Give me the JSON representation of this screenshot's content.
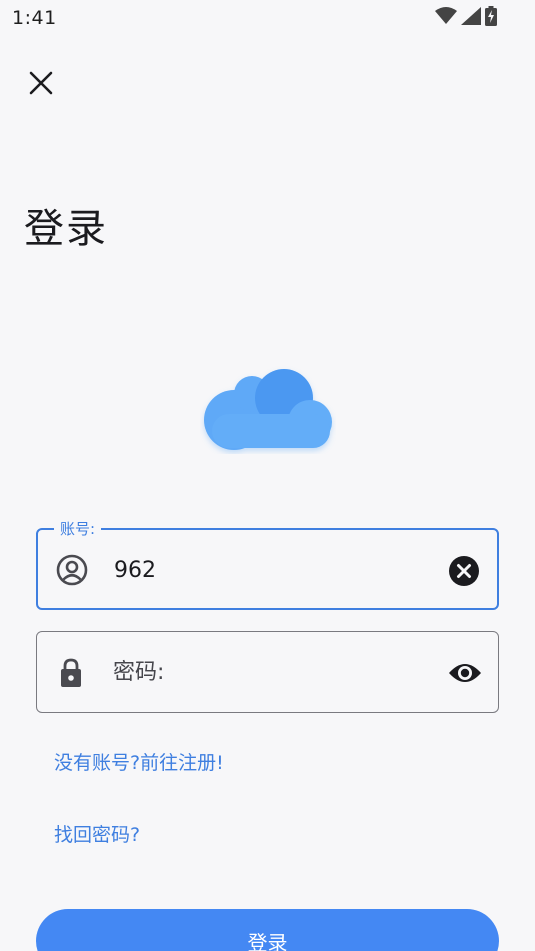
{
  "status_bar": {
    "time": "1:41",
    "icons": [
      "wifi-icon",
      "cellular-signal-icon",
      "battery-charging-icon"
    ]
  },
  "header": {
    "close_icon": "close-icon",
    "title": "登录"
  },
  "logo": {
    "icon": "cloud-icon",
    "color": "#5aa5f5"
  },
  "account_field": {
    "label": "账号:",
    "value": "962",
    "leading_icon": "account-circle-icon",
    "trailing_icon": "clear-icon",
    "focused": true
  },
  "password_field": {
    "placeholder": "密码:",
    "value": "",
    "leading_icon": "lock-icon",
    "trailing_icon": "visibility-icon"
  },
  "links": {
    "register": "没有账号?前往注册!",
    "forgot_password": "找回密码?"
  },
  "login_button": {
    "label": "登录"
  },
  "colors": {
    "accent": "#3f7fe0",
    "button": "#4488f3",
    "background": "#f7f7f9"
  }
}
